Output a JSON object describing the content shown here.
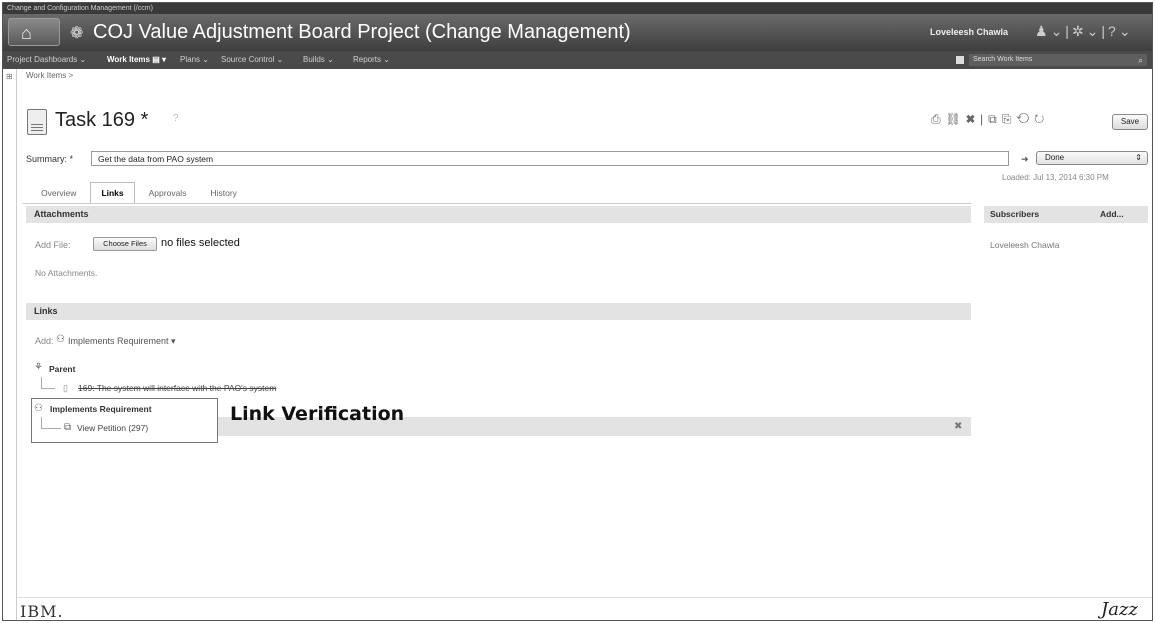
{
  "topbar": {
    "text": "Change and Configuration Management (/ccm)"
  },
  "banner": {
    "title": "COJ Value Adjustment Board Project (Change Management)",
    "user": "Loveleesh Chawla",
    "icons": [
      "people-icon",
      "gear-icon",
      "help-icon"
    ]
  },
  "menu": {
    "items": [
      "Project Dashboards ⌄",
      "Work Items ▤ ▾",
      "Plans ⌄",
      "Source Control ⌄",
      "Builds ⌄",
      "Reports ⌄"
    ],
    "search_placeholder": "Search Work Items"
  },
  "breadcrumb": "Work Items >",
  "task": {
    "title": "Task 169 *",
    "save_label": "Save"
  },
  "summary": {
    "label": "Summary: *",
    "value": "Get the data from PAO system",
    "status": "Done",
    "loaded": "Loaded: Jul 13, 2014 6:30 PM"
  },
  "tabs": [
    "Overview",
    "Links",
    "Approvals",
    "History"
  ],
  "attachments": {
    "header": "Attachments",
    "add_file_label": "Add File:",
    "choose_button": "Choose Files",
    "no_files": "no files selected",
    "none": "No Attachments."
  },
  "links": {
    "header": "Links",
    "add_label": "Add:",
    "add_link": "Implements Requirement ▾",
    "parent_label": "Parent",
    "parent_item": "169: The system will interface with the PAO's system",
    "implements_label": "Implements Requirement",
    "implements_item": "View Petition (297)"
  },
  "annotation": "Link Verification",
  "subscribers": {
    "header": "Subscribers",
    "add": "Add...",
    "names": [
      "Loveleesh Chawla"
    ]
  },
  "footer": {
    "ibm": "IBM.",
    "jazz": "Jazz"
  }
}
